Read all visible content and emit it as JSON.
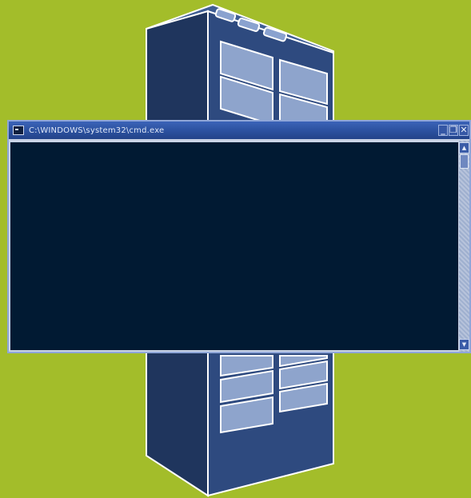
{
  "window": {
    "title": "C:\\WINDOWS\\system32\\cmd.exe",
    "controls": {
      "minimize": "_",
      "maximize": "❐",
      "close": "✕"
    }
  },
  "scrollbar": {
    "up": "▲",
    "down": "▼"
  },
  "colors": {
    "background": "#a3bd2a",
    "server_front": "#2e4a7f",
    "server_side": "#1f355d",
    "console_body": "#011a33",
    "title_bar": "#2a4f9c"
  }
}
